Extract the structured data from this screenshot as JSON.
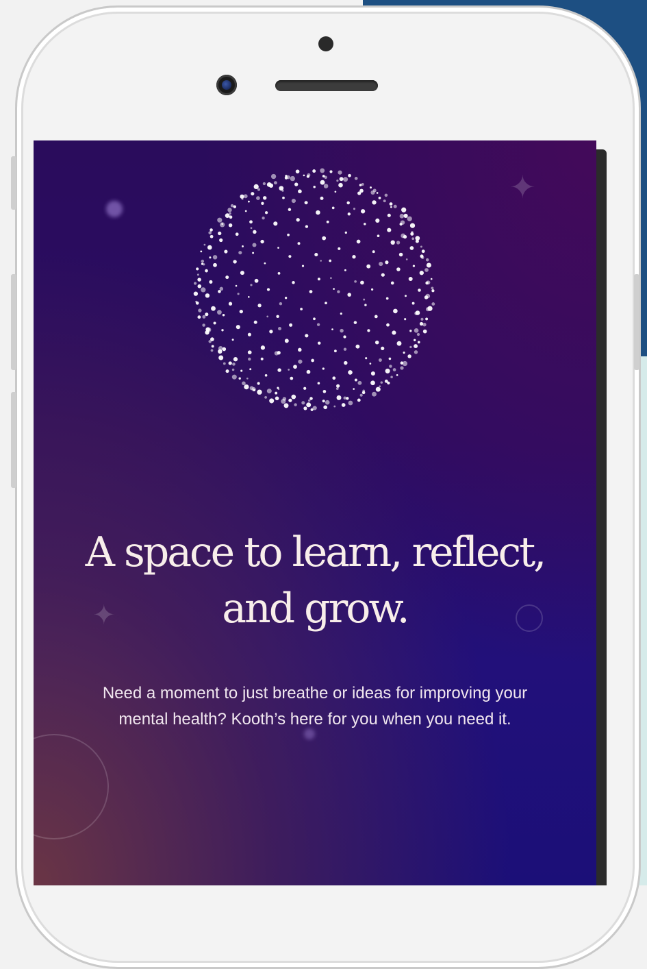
{
  "hero": {
    "headline_line1": "A space to learn, reflect,",
    "headline_line2": "and grow.",
    "subtext_line1": "Need a moment to just breathe or ideas for improving your",
    "subtext_line2": "mental health? Kooth’s here for you when you need it."
  },
  "colors": {
    "screen_top": "#2a0c5c",
    "screen_bottom_left": "#5a3040",
    "screen_bottom_right": "#1b0f78",
    "headline_text": "#f8eeea",
    "backdrop_blue": "#1d4f82",
    "backdrop_mint": "#d6ebea"
  },
  "icons": {
    "hero_graphic": "particle-sphere-icon",
    "decor": [
      "sparkle-icon",
      "ring-icon",
      "glow-dot-icon"
    ]
  }
}
